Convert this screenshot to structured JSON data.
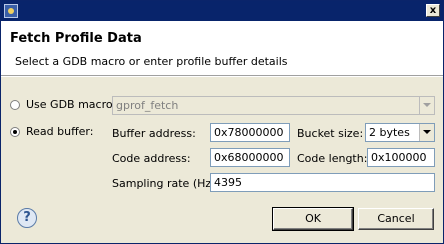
{
  "window": {
    "close_symbol": "x"
  },
  "header": {
    "title": "Fetch Profile Data",
    "description": "Select a GDB macro or enter profile buffer details"
  },
  "options": {
    "gdb_macro": {
      "label": "Use GDB macro:",
      "selected": false,
      "value": "gprof_fetch"
    },
    "read_buffer": {
      "label": "Read buffer:",
      "selected": true
    }
  },
  "fields": {
    "buffer_address": {
      "label": "Buffer address:",
      "value": "0x78000000"
    },
    "bucket_size": {
      "label": "Bucket size:",
      "value": "2 bytes"
    },
    "code_address": {
      "label": "Code address:",
      "value": "0x68000000"
    },
    "code_length": {
      "label": "Code length:",
      "value": "0x100000"
    },
    "sampling_rate": {
      "label": "Sampling rate (Hz):",
      "value": "4395"
    }
  },
  "buttons": {
    "help_symbol": "?",
    "ok": "OK",
    "cancel": "Cancel"
  }
}
